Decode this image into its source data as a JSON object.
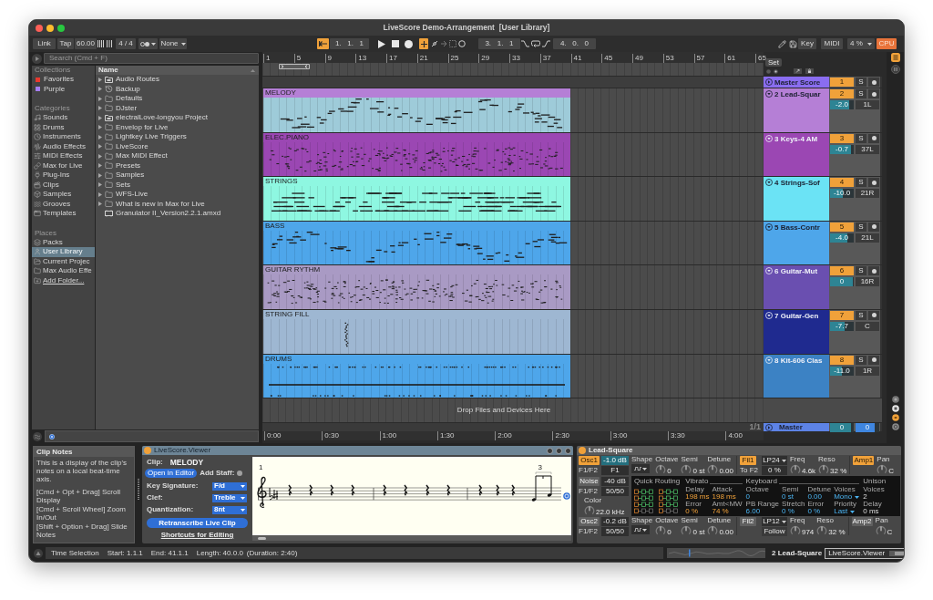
{
  "window": {
    "title": "LiveScore Demo-Arrangement  [User Library]"
  },
  "control_bar": {
    "link": "Link",
    "tap": "Tap",
    "tempo": "60.00",
    "time_signature": "4 / 4",
    "quantization": "None",
    "back_to_arrangement": {
      "on": true
    },
    "arrangement_position": "1.   1.   1",
    "overdub": {
      "on": true
    },
    "loop_start": "3.   1.   1",
    "loop_length": "4.   0.   0",
    "key": "Key",
    "midi": "MIDI",
    "cpu_load": "4 %",
    "cpu": "CPU"
  },
  "browser": {
    "search": {
      "placeholder": "Search (Cmd + F)"
    },
    "sidebar": [
      {
        "heading": "Collections",
        "items": [
          {
            "label": "Favorites",
            "kind": "tag",
            "color": "#e8392f",
            "selected": false
          },
          {
            "label": "Purple",
            "kind": "tag",
            "color": "#a47ef2",
            "selected": false
          }
        ]
      },
      {
        "heading": "Categories",
        "items": [
          {
            "label": "Sounds",
            "kind": "category",
            "selected": false
          },
          {
            "label": "Drums",
            "kind": "category",
            "selected": false
          },
          {
            "label": "Instruments",
            "kind": "category",
            "selected": false
          },
          {
            "label": "Audio Effects",
            "kind": "category",
            "selected": false
          },
          {
            "label": "MIDI Effects",
            "kind": "category",
            "selected": false
          },
          {
            "label": "Max for Live",
            "kind": "category",
            "selected": false
          },
          {
            "label": "Plug-Ins",
            "kind": "category",
            "selected": false
          },
          {
            "label": "Clips",
            "kind": "category",
            "selected": false
          },
          {
            "label": "Samples",
            "kind": "category",
            "selected": false
          },
          {
            "label": "Grooves",
            "kind": "category",
            "selected": false
          },
          {
            "label": "Templates",
            "kind": "category",
            "selected": false
          }
        ]
      },
      {
        "heading": "Places",
        "items": [
          {
            "label": "Packs",
            "kind": "place",
            "selected": false
          },
          {
            "label": "User Library",
            "kind": "place",
            "selected": true
          },
          {
            "label": "Current Projec",
            "kind": "place",
            "selected": false
          },
          {
            "label": "Max Audio Effe",
            "kind": "place",
            "selected": false
          },
          {
            "label": "Add Folder...",
            "kind": "action",
            "selected": false
          }
        ]
      }
    ],
    "column_header": "Name",
    "items": [
      {
        "label": "Audio Routes",
        "kind": "project",
        "expanded": false
      },
      {
        "label": "Backup",
        "kind": "backup",
        "expanded": false
      },
      {
        "label": "Defaults",
        "kind": "folder",
        "expanded": false
      },
      {
        "label": "DJster",
        "kind": "folder",
        "expanded": false
      },
      {
        "label": "electralLove-longyou Project",
        "kind": "project",
        "expanded": false
      },
      {
        "label": "Envelop for Live",
        "kind": "folder",
        "expanded": false
      },
      {
        "label": "Lightkey Live Triggers",
        "kind": "folder",
        "expanded": false
      },
      {
        "label": "LiveScore",
        "kind": "folder",
        "expanded": false
      },
      {
        "label": "Max MIDI Effect",
        "kind": "folder",
        "expanded": false
      },
      {
        "label": "Presets",
        "kind": "folder",
        "expanded": false
      },
      {
        "label": "Samples",
        "kind": "folder",
        "expanded": false
      },
      {
        "label": "Sets",
        "kind": "folder",
        "expanded": false
      },
      {
        "label": "WFS-Live",
        "kind": "folder",
        "expanded": false
      },
      {
        "label": "What is new in Max for Live",
        "kind": "folder",
        "expanded": false
      },
      {
        "label": "Granulator II_Version2.2.1.amxd",
        "kind": "device"
      }
    ]
  },
  "arrangement": {
    "bar_numbers": [
      "1",
      "5",
      "9",
      "13",
      "17",
      "21",
      "25",
      "29",
      "33",
      "37",
      "41",
      "45",
      "49",
      "53",
      "57",
      "61",
      "65"
    ],
    "set_label": "Set",
    "tracks": [
      {
        "name": "Master Score",
        "color": "#8a6df0",
        "expanded": false,
        "number": "1",
        "active": true,
        "solo": {
          "label": "S",
          "on": false
        },
        "arm": false
      },
      {
        "name": "2 Lead-Squar",
        "color": "#b57fd6",
        "expanded": true,
        "number": "2",
        "active": true,
        "solo": {
          "label": "S",
          "on": false
        },
        "arm": false,
        "volume": {
          "value": "-2.0",
          "level": 0.82
        },
        "pan": "1L",
        "clip": {
          "name": "MELODY",
          "color": "#b57fd6",
          "selected": true
        }
      },
      {
        "name": "3 Keys-4 AM",
        "color": "#9b47b3",
        "expanded": true,
        "number": "3",
        "active": true,
        "solo": {
          "label": "S",
          "on": false
        },
        "arm": false,
        "volume": {
          "value": "-0.7",
          "level": 0.9
        },
        "pan": "37L",
        "clip": {
          "name": "ELEC.PIANO",
          "color": "#9b47b3",
          "selected": false
        }
      },
      {
        "name": "4 Strings-Sof",
        "color": "#6be3f5",
        "expanded": true,
        "number": "4",
        "active": true,
        "solo": {
          "label": "S",
          "on": false
        },
        "arm": false,
        "volume": {
          "value": "-10.0",
          "level": 0.55
        },
        "pan": "21R",
        "clip": {
          "name": "STRINGS",
          "color": "#8ef7e1",
          "selected": false
        }
      },
      {
        "name": "5 Bass-Contr",
        "color": "#4ea6ea",
        "expanded": true,
        "number": "5",
        "active": true,
        "solo": {
          "label": "S",
          "on": false
        },
        "arm": false,
        "volume": {
          "value": "-4.0",
          "level": 0.72
        },
        "pan": "21L",
        "clip": {
          "name": "BASS",
          "color": "#4ea6ea",
          "selected": false
        }
      },
      {
        "name": "6 Guitar-Mut",
        "color": "#6a4fb0",
        "expanded": true,
        "number": "6",
        "active": true,
        "solo": {
          "label": "S",
          "on": false
        },
        "arm": false,
        "volume": {
          "value": "0",
          "level": 0.95
        },
        "pan": "16R",
        "clip": {
          "name": "GUITAR RYTHM",
          "color": "#a99ac4",
          "selected": false
        }
      },
      {
        "name": "7 Guitar-Gen",
        "color": "#1f2a8f",
        "expanded": true,
        "number": "7",
        "active": true,
        "solo": {
          "label": "S",
          "on": false
        },
        "arm": false,
        "volume": {
          "value": "-7.7",
          "level": 0.62
        },
        "pan": "C",
        "clip": {
          "name": "STRING FILL",
          "color": "#9eb7d2",
          "selected": false
        }
      },
      {
        "name": "8 Kit-606 Clas",
        "color": "#3c82c4",
        "expanded": true,
        "number": "8",
        "active": true,
        "solo": {
          "label": "S",
          "on": false
        },
        "arm": false,
        "volume": {
          "value": "-11.0",
          "level": 0.5
        },
        "pan": "1R",
        "clip": {
          "name": "DRUMS",
          "color": "#4ea6ea",
          "selected": false
        }
      }
    ],
    "drop_hint": "Drop Files and Devices Here",
    "page": "1/1",
    "master": {
      "name": "Master",
      "color": "#5d83e6",
      "expanded": false,
      "volume": {
        "value": "0",
        "level": 0.9
      },
      "cue_volume": {
        "value": "0",
        "level": 0.8
      }
    },
    "time_marks": [
      "0:00",
      "0:30",
      "1:00",
      "1:30",
      "2:00",
      "2:30",
      "3:00",
      "3:30",
      "4:00"
    ]
  },
  "clip_notes": {
    "title": "Clip Notes",
    "description": "This is a display of the clip's notes on a local beat-time axis.",
    "shortcuts": [
      "[Cmd + Opt + Drag] Scroll Display",
      "[Cmd + Scroll Wheel] Zoom In/Out",
      "[Shift + Option + Drag] Slide Notes"
    ]
  },
  "score_viewer": {
    "title": "LiveScore.Viewer",
    "on": true,
    "clip_label": "Clip:",
    "clip": "MELODY",
    "open_button": "Open in Editor",
    "add_staff_label": "Add Staff:",
    "add_staff_on": false,
    "settings": [
      {
        "label": "Key Signature:",
        "value": "F/d"
      },
      {
        "label": "Clef:",
        "value": "Treble"
      },
      {
        "label": "Quantization:",
        "value": "8nt"
      }
    ],
    "retranscribe_button": "Retranscribe Live Clip",
    "shortcuts_link": "Shortcuts for Editing",
    "measure_number": "1",
    "tuplet_number": "3"
  },
  "synth": {
    "title": "Lead-Square",
    "on": true,
    "osc_rows": [
      {
        "osc": {
          "label": "Osc1",
          "on": true
        },
        "gain": {
          "value": "-1.0 dB",
          "selected": true
        },
        "route_label": "F1/F2",
        "route": "F1",
        "shape_label": "Shape",
        "knobs": [
          {
            "label": "Octave",
            "value": "0"
          },
          {
            "label": "Semi",
            "value": "0 st"
          },
          {
            "label": "Detune",
            "value": "0.00"
          }
        ],
        "filter": {
          "label": "Fil1",
          "on": true
        },
        "filter_type": "LP24",
        "filter_extra": {
          "kind": "field",
          "label": "To F2",
          "value": "0 %"
        },
        "filter_knobs": [
          {
            "label": "Freq",
            "value": "4.6k"
          },
          {
            "label": "Reso",
            "value": "32 %"
          }
        ],
        "amp": {
          "label": "Amp1",
          "on": true
        },
        "pan": {
          "label": "Pan",
          "value": "C"
        }
      },
      {
        "osc": {
          "label": "Osc2",
          "on": false
        },
        "gain": {
          "value": "-0.2 dB",
          "selected": false
        },
        "route_label": "F1/F2",
        "route": "50/50",
        "shape_label": "Shape",
        "knobs": [
          {
            "label": "Octave",
            "value": "0"
          },
          {
            "label": "Semi",
            "value": "0 st"
          },
          {
            "label": "Detune",
            "value": "0.00"
          }
        ],
        "filter": {
          "label": "Fil2",
          "on": false
        },
        "filter_type": "LP12",
        "filter_extra": {
          "kind": "button",
          "value": "Follow"
        },
        "filter_knobs": [
          {
            "label": "Freq",
            "value": "974"
          },
          {
            "label": "Reso",
            "value": "32 %"
          }
        ],
        "amp": {
          "label": "Amp2",
          "on": false
        },
        "pan": {
          "label": "Pan",
          "value": "C"
        }
      }
    ],
    "noise": {
      "toggle": {
        "label": "Noise",
        "on": false
      },
      "gain": {
        "value": "-40 dB",
        "selected": false
      },
      "route_label": "F1/F2",
      "route": "50/50",
      "knob": {
        "label": "Color",
        "value": "22.0 kHz"
      }
    },
    "display": {
      "routing_label": "Quick Routing",
      "sections": [
        {
          "title": "Vibrato",
          "params": [
            {
              "label": "Delay",
              "value": "198 ms",
              "kind": "number"
            },
            {
              "label": "Error",
              "value": "0 %",
              "kind": "number"
            },
            {
              "label": "Attack",
              "value": "198 ms",
              "kind": "number"
            },
            {
              "label": "Amt<MW",
              "value": "74 %",
              "kind": "number"
            }
          ]
        },
        {
          "title": "Keyboard",
          "params": [
            {
              "label": "Octave",
              "value": "0",
              "kind": "number"
            },
            {
              "label": "PB Range",
              "value": "6.00",
              "kind": "number"
            },
            {
              "label": "Semi",
              "value": "0 st",
              "kind": "number"
            },
            {
              "label": "Stretch",
              "value": "0 %",
              "kind": "number"
            },
            {
              "label": "Detune",
              "value": "0.00",
              "kind": "number"
            },
            {
              "label": "Error",
              "value": "0 %",
              "kind": "number"
            },
            {
              "label": "Voices",
              "value": "Mono",
              "kind": "menu"
            },
            {
              "label": "Priority",
              "value": "Last",
              "kind": "menu"
            }
          ]
        },
        {
          "title": "Unison",
          "params": [
            {
              "label": "Voices",
              "value": "2",
              "kind": "number"
            },
            {
              "label": "Delay",
              "value": "0 ms",
              "kind": "number"
            }
          ]
        }
      ]
    }
  },
  "status_bar": {
    "mode": "Time Selection",
    "start": "Start: 1.1.1",
    "end": "End: 41.1.1",
    "length": "Length: 40.0.0",
    "duration": "(Duration: 2:40)",
    "selected_track": "2 Lead-Square",
    "device_tab": "LiveScore.Viewer"
  }
}
